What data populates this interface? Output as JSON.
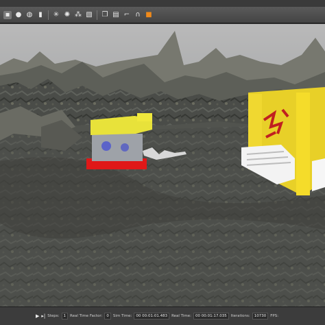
{
  "toolbar": {
    "icons": [
      "select-arrow-icon",
      "translate-icon",
      "rotate-icon",
      "scale-icon",
      "box-icon",
      "sphere-icon",
      "cylinder-icon",
      "point-light-icon",
      "spot-light-icon",
      "directional-light-icon",
      "copy-icon",
      "paste-icon",
      "align-icon",
      "snap-icon",
      "screenshot-icon"
    ]
  },
  "status": {
    "play_glyph": "▶",
    "step_glyph": "▸|",
    "steps_label": "Steps:",
    "steps_value": "1",
    "rtf_label": "Real Time Factor:",
    "rtf_value": "0",
    "sim_label": "Sim Time:",
    "sim_value": "00 00:01:01.483",
    "real_label": "Real Time:",
    "real_value": "00 00:01:17.035",
    "iter_label": "Iterations:",
    "iter_value": "10730",
    "fps_label": "FPS:"
  }
}
